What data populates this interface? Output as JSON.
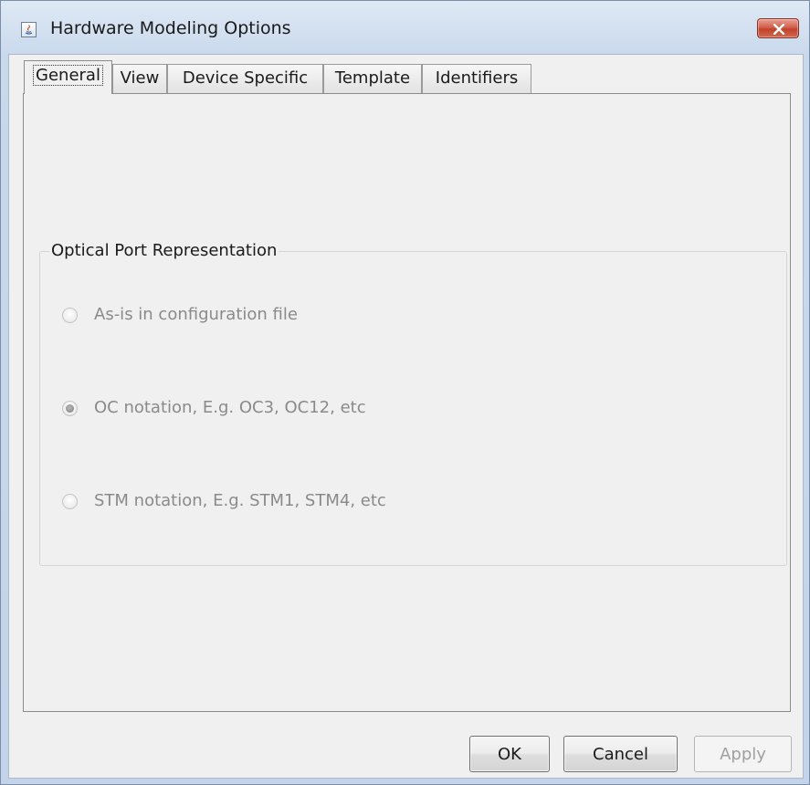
{
  "window": {
    "title": "Hardware Modeling Options"
  },
  "tabs": [
    {
      "label": "General",
      "active": true
    },
    {
      "label": "View",
      "active": false
    },
    {
      "label": "Device Specific",
      "active": false
    },
    {
      "label": "Template",
      "active": false
    },
    {
      "label": "Identifiers",
      "active": false
    }
  ],
  "optical_port": {
    "group_title": "Optical Port Representation",
    "options": [
      {
        "label": "As-is in configuration file",
        "checked": false,
        "enabled": false
      },
      {
        "label": "OC notation, E.g. OC3, OC12, etc",
        "checked": true,
        "enabled": false
      },
      {
        "label": "STM notation, E.g. STM1, STM4, etc",
        "checked": false,
        "enabled": false
      }
    ]
  },
  "buttons": {
    "ok": "OK",
    "cancel": "Cancel",
    "apply": "Apply"
  },
  "colors": {
    "close_button": "#c9452f",
    "client_background": "#f0f0f0",
    "disabled_text": "#8a8a8a"
  }
}
